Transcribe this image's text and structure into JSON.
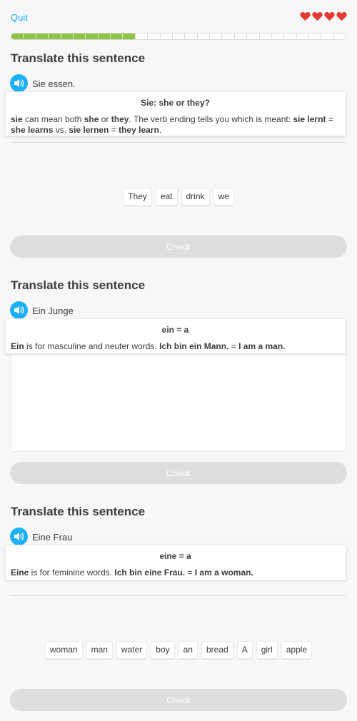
{
  "header": {
    "quit_label": "Quit",
    "hearts": 4,
    "progress": {
      "completed": 10,
      "total": 27,
      "fill_color": "#8ec34a"
    }
  },
  "accent_color": "#1cb0f6",
  "heart_color": "#e53935",
  "exercises": [
    {
      "title": "Translate this sentence",
      "prompt": "Sie essen.",
      "tip": {
        "title": "Sie: she or they?",
        "parts": [
          {
            "b": true,
            "t": "sie"
          },
          {
            "b": false,
            "t": " can mean both "
          },
          {
            "b": true,
            "t": "she"
          },
          {
            "b": false,
            "t": " or "
          },
          {
            "b": true,
            "t": "they"
          },
          {
            "b": false,
            "t": ". The verb ending tells you which is meant: "
          },
          {
            "b": true,
            "t": "sie lernt"
          },
          {
            "b": false,
            "t": " = "
          },
          {
            "b": true,
            "t": "she learns"
          },
          {
            "b": false,
            "t": " vs. "
          },
          {
            "b": true,
            "t": "sie lernen"
          },
          {
            "b": false,
            "t": " = "
          },
          {
            "b": true,
            "t": "they learn"
          },
          {
            "b": false,
            "t": "."
          }
        ]
      },
      "words": [
        "They",
        "eat",
        "drink",
        "we"
      ],
      "check_label": "Check"
    },
    {
      "title": "Translate this sentence",
      "prompt": "Ein Junge",
      "tip": {
        "title": "ein = a",
        "parts": [
          {
            "b": true,
            "t": "Ein"
          },
          {
            "b": false,
            "t": " is for masculine and neuter words. "
          },
          {
            "b": true,
            "t": "Ich bin ein Mann."
          },
          {
            "b": false,
            "t": " = "
          },
          {
            "b": true,
            "t": "I am a man."
          }
        ]
      },
      "check_label": "Check"
    },
    {
      "title": "Translate this sentence",
      "prompt": "Eine Frau",
      "tip": {
        "title": "eine = a",
        "parts": [
          {
            "b": true,
            "t": "Eine"
          },
          {
            "b": false,
            "t": " is for feminine words. "
          },
          {
            "b": true,
            "t": "Ich bin eine Frau."
          },
          {
            "b": false,
            "t": " = "
          },
          {
            "b": true,
            "t": "I am a woman."
          }
        ]
      },
      "words": [
        "woman",
        "man",
        "water",
        "boy",
        "an",
        "bread",
        "A",
        "girl",
        "apple"
      ],
      "check_label": "Check"
    }
  ]
}
